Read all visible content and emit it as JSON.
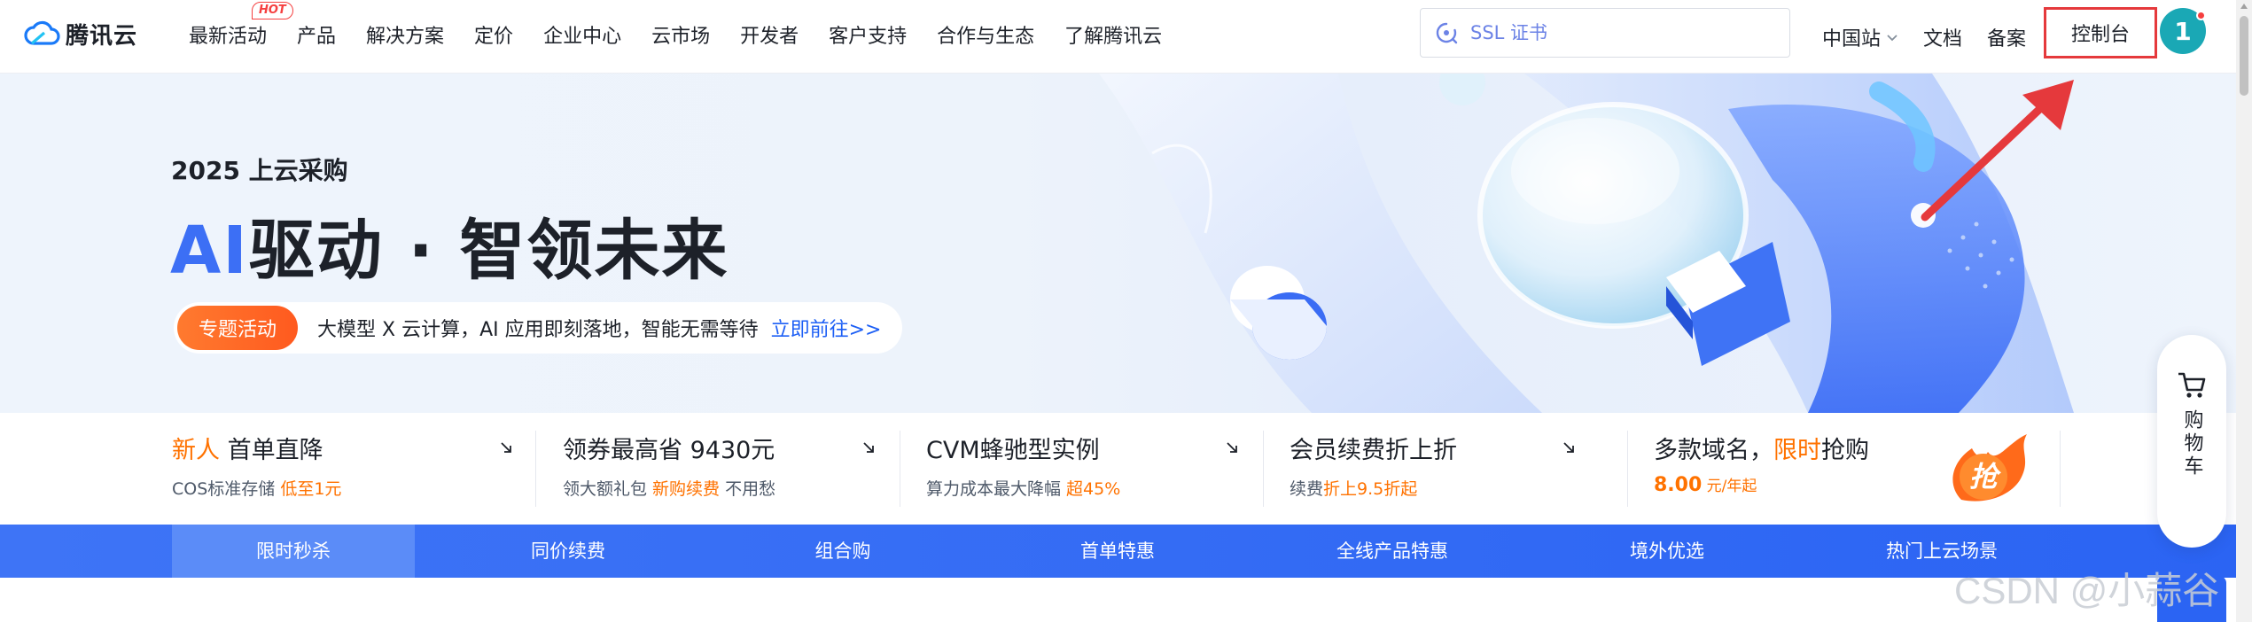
{
  "logo": {
    "text": "腾讯云"
  },
  "nav": {
    "items": [
      {
        "label": "最新活动",
        "badge": "HOT"
      },
      {
        "label": "产品"
      },
      {
        "label": "解决方案"
      },
      {
        "label": "定价"
      },
      {
        "label": "企业中心"
      },
      {
        "label": "云市场"
      },
      {
        "label": "开发者"
      },
      {
        "label": "客户支持"
      },
      {
        "label": "合作与生态"
      },
      {
        "label": "了解腾讯云"
      }
    ]
  },
  "search": {
    "placeholder": "SSL 证书"
  },
  "right_nav": {
    "region": "中国站",
    "docs": "文档",
    "filing": "备案",
    "console": "控制台",
    "avatar": "1"
  },
  "hero": {
    "year": "2025 上云采购",
    "title_ai": "AI",
    "title_rest": "驱动 · 智领未来",
    "tag": "专题活动",
    "text": "大模型 X 云计算，AI 应用即刻落地，智能无需等待",
    "link": "立即前往>>"
  },
  "promos": [
    {
      "title_hl": "新人",
      "title": " 首单直降",
      "sub": "COS标准存储 ",
      "sub_hl": "低至1元"
    },
    {
      "title": "领券最高省 9430元",
      "sub_pre": "领大额礼包 ",
      "sub_hl": "新购续费",
      "sub_post": " 不用愁"
    },
    {
      "title": "CVM蜂驰型实例",
      "sub_pre": "算力成本最大降幅 ",
      "sub_hl": "超45%"
    },
    {
      "title": "会员续费折上折",
      "sub_pre": "续费",
      "sub_hl": "折上9.5折起"
    },
    {
      "title_pre": "多款域名，",
      "title_hl": "限时",
      "title_post": "抢购",
      "price": "8.00",
      "unit": " 元/年起",
      "badge": "抢"
    }
  ],
  "tabs": [
    "限时秒杀",
    "同价续费",
    "组合购",
    "首单特惠",
    "全线产品特惠",
    "境外优选",
    "热门上云场景"
  ],
  "cart": {
    "label": "购物车"
  },
  "watermark": "CSDN @小蒜谷",
  "colors": {
    "brand_blue": "#2b64f3",
    "accent_orange": "#ff7200",
    "highlight_red": "#e5393c"
  }
}
